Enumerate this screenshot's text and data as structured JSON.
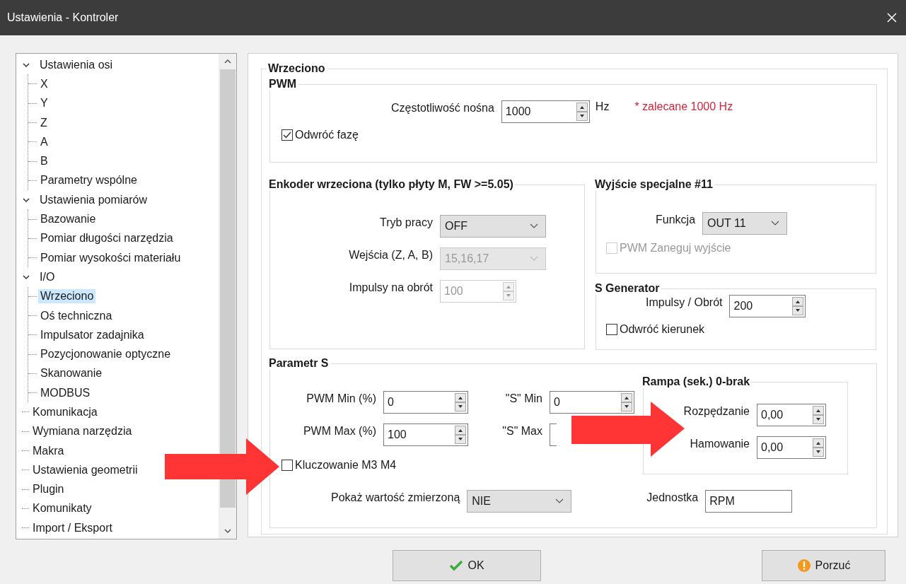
{
  "window": {
    "title": "Ustawienia - Kontroler"
  },
  "tree": [
    {
      "label": "Ustawienia osi",
      "selected": false,
      "expanded": true,
      "children": [
        {
          "label": "X",
          "selected": false
        },
        {
          "label": "Y",
          "selected": false
        },
        {
          "label": "Z",
          "selected": false
        },
        {
          "label": "A",
          "selected": false
        },
        {
          "label": "B",
          "selected": false
        },
        {
          "label": "Parametry wspólne",
          "selected": false
        }
      ]
    },
    {
      "label": "Ustawienia pomiarów",
      "selected": false,
      "expanded": true,
      "children": [
        {
          "label": "Bazowanie",
          "selected": false
        },
        {
          "label": "Pomiar długości narzędzia",
          "selected": false
        },
        {
          "label": "Pomiar wysokości materiału",
          "selected": false
        }
      ]
    },
    {
      "label": "I/O",
      "selected": false,
      "expanded": true,
      "children": [
        {
          "label": "Wrzeciono",
          "selected": true
        },
        {
          "label": "Oś techniczna",
          "selected": false
        },
        {
          "label": "Impulsator zadajnika",
          "selected": false
        },
        {
          "label": "Pozycjonowanie optyczne",
          "selected": false
        },
        {
          "label": "Skanowanie",
          "selected": false
        },
        {
          "label": "MODBUS",
          "selected": false
        }
      ]
    },
    {
      "label": "Komunikacja",
      "selected": false
    },
    {
      "label": "Wymiana narzędzia",
      "selected": false
    },
    {
      "label": "Makra",
      "selected": false
    },
    {
      "label": "Ustawienia geometrii",
      "selected": false
    },
    {
      "label": "Plugin",
      "selected": false
    },
    {
      "label": "Komunikaty",
      "selected": false
    },
    {
      "label": "Import / Eksport",
      "selected": false
    }
  ],
  "panel": {
    "title": "Wrzeciono",
    "pwm": {
      "title": "PWM",
      "frequency": {
        "label": "Częstotliwość nośna",
        "value": "1000",
        "unit": "Hz",
        "note": "* zalecane 1000 Hz"
      },
      "invert_phase": {
        "label": "Odwróć fazę",
        "checked": true
      }
    },
    "encoder": {
      "title": "Enkoder wrzeciona (tylko płyty M, FW >=5.05)",
      "rows": [
        {
          "kind": "combo",
          "label": "Tryb pracy",
          "value": "OFF",
          "disabled": false
        },
        {
          "kind": "combo",
          "label": "Wejścia (Z, A, B)",
          "value": "15,16,17",
          "disabled": true
        },
        {
          "kind": "spin",
          "label": "Impulsy na obrót",
          "value": "100",
          "disabled": true
        }
      ]
    },
    "special_output": {
      "title": "Wyjście specjalne #11",
      "function": {
        "label": "Funkcja",
        "value": "OUT 11"
      },
      "pwm_negate": {
        "label": "PWM Zaneguj wyjście",
        "checked": false,
        "disabled": true
      }
    },
    "s_generator": {
      "title": "S Generator",
      "pulses": {
        "label": "Impulsy / Obrót",
        "value": "200"
      },
      "reverse": {
        "label": "Odwróć kierunek",
        "checked": false,
        "disabled": false
      }
    },
    "parameter_s": {
      "title": "Parametr S",
      "pwm_min": {
        "label": "PWM Min (%)",
        "value": "0"
      },
      "pwm_max": {
        "label": "PWM Max (%)",
        "value": "100"
      },
      "s_min": {
        "label": "\"S\" Min",
        "value": "0"
      },
      "s_max": {
        "label": "\"S\" Max"
      },
      "keying": {
        "label": "Kluczowanie M3 M4",
        "checked": false,
        "disabled": false
      },
      "ramp": {
        "title": "Rampa (sek.) 0-brak",
        "rows": [
          {
            "label": "Rozpędzanie",
            "value": "0,00"
          },
          {
            "label": "Hamowanie",
            "value": "0,00"
          }
        ]
      },
      "show_measured": {
        "label": "Pokaż wartość zmierzoną",
        "value": "NIE"
      },
      "unit": {
        "label": "Jednostka",
        "value": "RPM"
      }
    }
  },
  "buttons": [
    {
      "kind": "ok",
      "label": "OK"
    },
    {
      "kind": "cancel",
      "label": "Porzuć"
    }
  ]
}
